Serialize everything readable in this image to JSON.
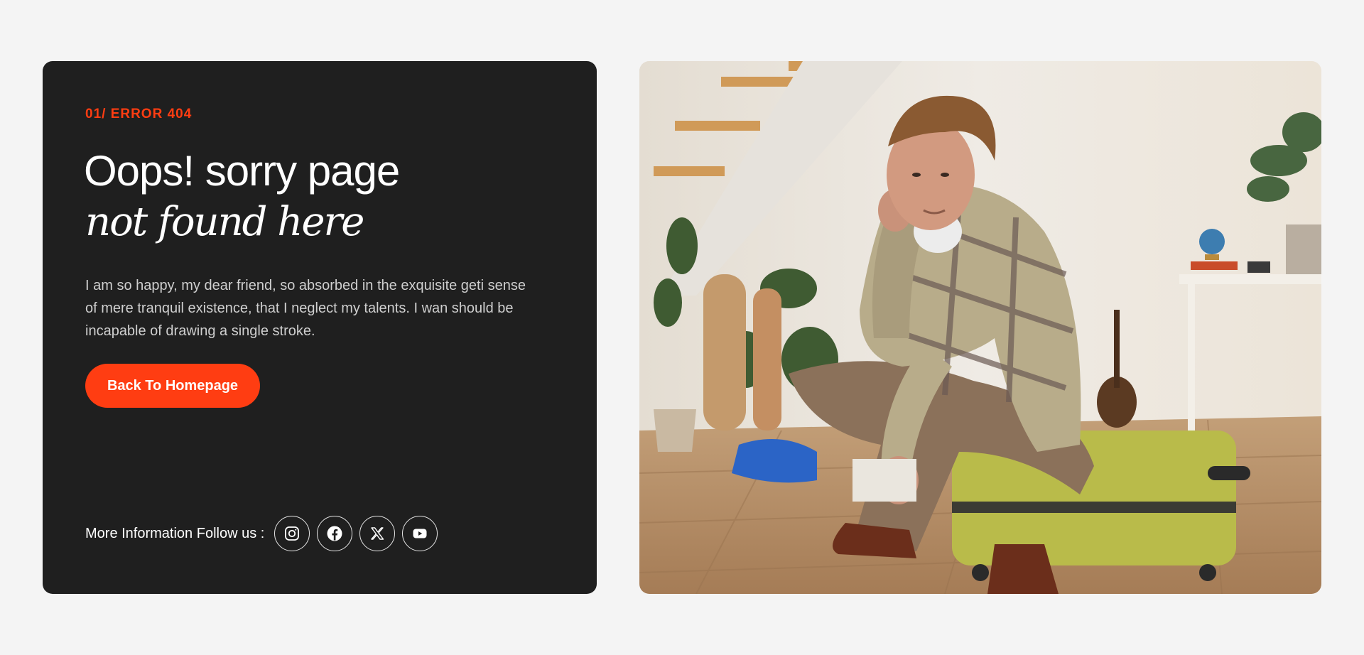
{
  "error": {
    "eyebrow": "01/ ERROR 404",
    "title_line1": "Oops! sorry page",
    "title_line2": "not found here",
    "description": "I am so happy, my dear friend, so absorbed in the exquisite geti sense of mere tranquil existence, that I neglect my talents. I wan should be incapable of drawing a single stroke.",
    "button_label": "Back To Homepage"
  },
  "follow": {
    "label": "More Information Follow us :",
    "icons": [
      "instagram-icon",
      "facebook-icon",
      "x-icon",
      "youtube-icon"
    ]
  },
  "colors": {
    "accent": "#ff3d12",
    "card_bg": "#1f1f1f",
    "page_bg": "#f4f4f4"
  }
}
